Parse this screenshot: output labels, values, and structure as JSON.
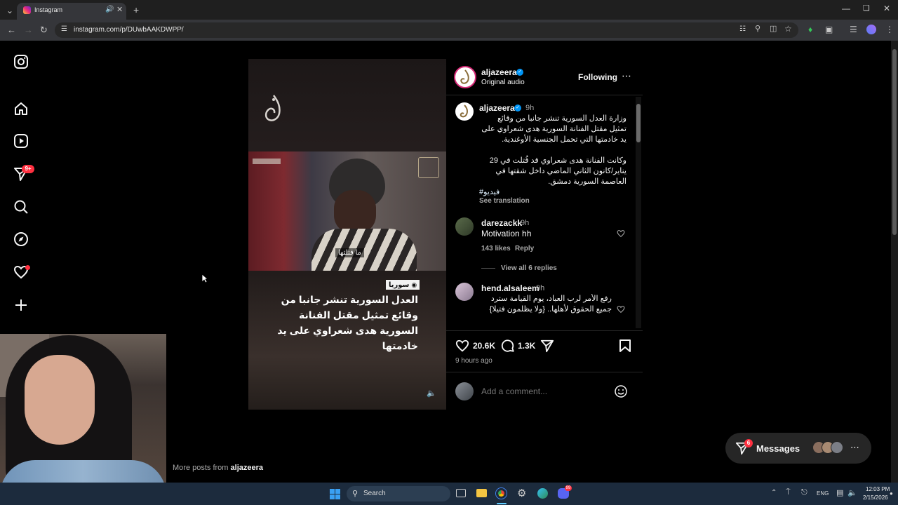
{
  "browser": {
    "tab_title": "Instagram",
    "url": "instagram.com/p/DUwbAAKDWPP/"
  },
  "sidebar": {
    "notifications_badge": "9+"
  },
  "post": {
    "account": "aljazeera",
    "audio": "Original audio",
    "following_label": "Following",
    "media": {
      "location_tag": "سوريا",
      "overlay_text": "العدل السورية تنشر جانبا من وقائع تمثيل مقتل الفنانة السورية هدى شعراوي على يد خادمتها",
      "video_caption": "ما قتلتها"
    },
    "caption": {
      "time": "9h",
      "paragraph1": "وزارة العدل السورية تنشر جانبا من وقائع تمثيل مقتل الفنانة السورية هدى شعراوي على يد خادمتها التي تحمل الجنسية الأوغندية.",
      "paragraph2": "وكانت الفنانة هدى شعراوي قد قُتلت في 29 يناير/كانون الثاني الماضي داخل شقتها في العاصمة السورية دمشق.",
      "hashtag": "#فيديو",
      "see_translation": "See translation"
    },
    "comments": [
      {
        "user": "darezackk",
        "time": "9h",
        "text": "Motivation hh",
        "likes": "143 likes",
        "reply": "Reply",
        "view_replies": "View all 6 replies"
      },
      {
        "user": "hend.alsaleem",
        "time": "9h",
        "text": "رفع الأمر لرب العباد، يوم القيامة سترد جميع الحقوق لأهلها.. {ولا يظلمون فتيلا}"
      }
    ],
    "likes": "20.6K",
    "comments_count": "1.3K",
    "posted_ago": "9 hours ago",
    "add_comment_placeholder": "Add a comment..."
  },
  "more_posts": {
    "prefix": "More posts from",
    "account": "aljazeera"
  },
  "messages": {
    "label": "Messages",
    "badge": "6"
  },
  "taskbar": {
    "search": "Search",
    "language": "ENG",
    "time": "12:03 PM",
    "date": "2/15/2026",
    "discord_badge": "99"
  },
  "colors": {
    "accent_blue": "#0095f6",
    "badge_red": "#ff3040",
    "verified": "#0095f6",
    "hashtag": "#e0f1ff"
  }
}
